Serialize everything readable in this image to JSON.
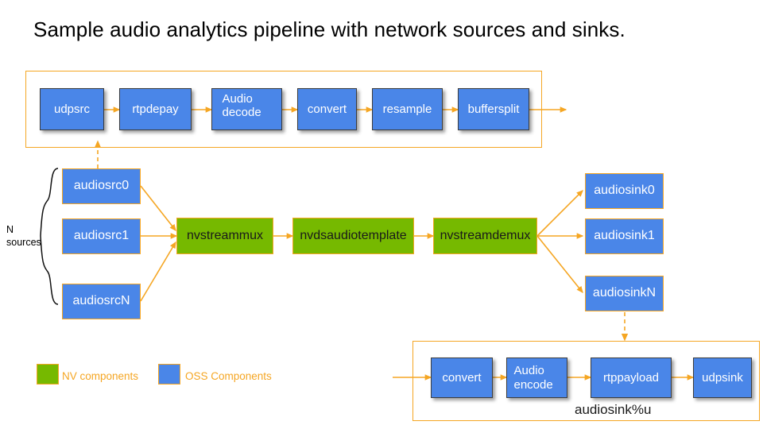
{
  "title": "Sample audio analytics pipeline with network sources and sinks.",
  "colors": {
    "nv_green": "#76b900",
    "oss_blue": "#4a86e8",
    "accent_orange": "#f5a623",
    "node_border_dark": "#3c3c3c",
    "background": "#ffffff",
    "text_dark": "#1a1a1a",
    "text_light": "#ffffff"
  },
  "source_pipeline": {
    "frame_name": "audio-source-pipeline-frame",
    "nodes": [
      {
        "id": "udpsrc",
        "label": "udpsrc"
      },
      {
        "id": "rtpdepay",
        "label": "rtpdepay"
      },
      {
        "id": "audiodecode",
        "label": "Audio decode"
      },
      {
        "id": "convert",
        "label": "convert"
      },
      {
        "id": "resample",
        "label": "resample"
      },
      {
        "id": "buffersplit",
        "label": "buffersplit"
      }
    ]
  },
  "sources": {
    "brace_label_line1": "N",
    "brace_label_line2": "sources",
    "nodes": [
      {
        "id": "audiosrc0",
        "label": "audiosrc0"
      },
      {
        "id": "audiosrc1",
        "label": "audiosrc1"
      },
      {
        "id": "audiosrcN",
        "label": "audiosrcN"
      }
    ]
  },
  "core": {
    "nodes": [
      {
        "id": "nvstreammux",
        "label": "nvstreammux"
      },
      {
        "id": "nvdsaudiotemplate",
        "label": "nvdsaudiotemplate"
      },
      {
        "id": "nvstreamdemux",
        "label": "nvstreamdemux"
      }
    ]
  },
  "sinks": {
    "nodes": [
      {
        "id": "audiosink0",
        "label": "audiosink0"
      },
      {
        "id": "audiosink1",
        "label": "audiosink1"
      },
      {
        "id": "audiosinkN",
        "label": "audiosinkN"
      }
    ]
  },
  "sink_pipeline": {
    "frame_name": "audio-sink-pipeline-frame",
    "frame_label": "audiosink%u",
    "nodes": [
      {
        "id": "convert",
        "label": "convert"
      },
      {
        "id": "audioencode",
        "label": "Audio encode"
      },
      {
        "id": "rtppayload",
        "label": "rtppayload"
      },
      {
        "id": "udpsink",
        "label": "udpsink"
      }
    ]
  },
  "legend": {
    "items": [
      {
        "id": "nv",
        "label": "NV components",
        "color": "#76b900"
      },
      {
        "id": "oss",
        "label": "OSS Components",
        "color": "#4a86e8"
      }
    ]
  }
}
